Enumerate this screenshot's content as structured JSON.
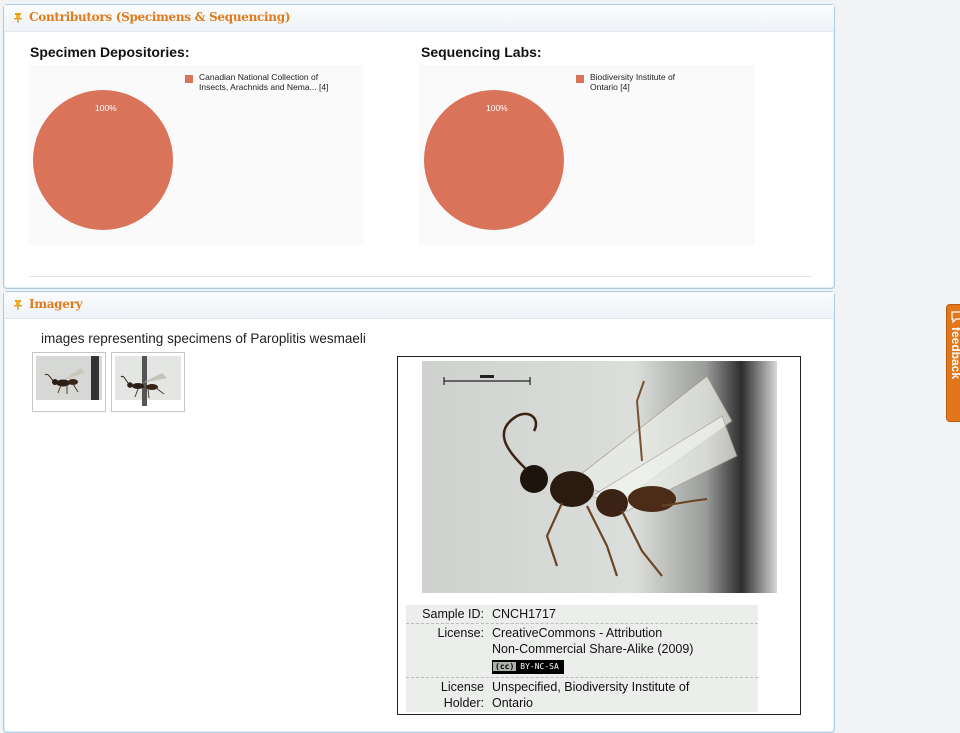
{
  "contributors": {
    "title": "Contributors (Specimens & Sequencing)",
    "depositories": {
      "heading": "Specimen Depositories:",
      "slice_label": "100%",
      "legend": "Canadian National Collection of Insects, Arachnids and Nema... [4]",
      "legend_line1": "Canadian National Collection of",
      "legend_line2": "Insects, Arachnids and Nema... [4]"
    },
    "labs": {
      "heading": "Sequencing Labs:",
      "slice_label": "100%",
      "legend": "Biodiversity Institute of Ontario [4]",
      "legend_line1": "Biodiversity Institute of",
      "legend_line2": "Ontario [4]"
    }
  },
  "chart_data": [
    {
      "type": "pie",
      "title": "Specimen Depositories:",
      "categories": [
        "Canadian National Collection of Insects, Arachnids and Nema... [4]"
      ],
      "values": [
        100
      ],
      "colors": [
        "#d9735a"
      ],
      "legend_position": "top-right"
    },
    {
      "type": "pie",
      "title": "Sequencing Labs:",
      "categories": [
        "Biodiversity Institute of Ontario [4]"
      ],
      "values": [
        100
      ],
      "colors": [
        "#d9735a"
      ],
      "legend_position": "top-right"
    }
  ],
  "imagery": {
    "title": "Imagery",
    "caption": "images representing specimens of Paroplitis wesmaeli",
    "thumbnails": [
      {
        "icon": "wasp-specimen-thumbnail"
      },
      {
        "icon": "wasp-specimen-thumbnail"
      }
    ],
    "viewer": {
      "sample_id_label": "Sample ID:",
      "sample_id": "CNCH1717",
      "license_label": "License:",
      "license_line1": "CreativeCommons - Attribution",
      "license_line2": "Non-Commercial Share-Alike (2009)",
      "badge_cc": "(cc)",
      "badge_terms": "BY-NC-SA",
      "holder_label_1": "License",
      "holder_label_2": "Holder:",
      "holder_line1": "Unspecified, Biodiversity Institute of",
      "holder_line2": "Ontario"
    }
  },
  "feedback": {
    "label": "feedback"
  },
  "colors": {
    "accent": "#e07b1b",
    "pie": "#d9735a",
    "panel_border": "#a9cde6"
  }
}
